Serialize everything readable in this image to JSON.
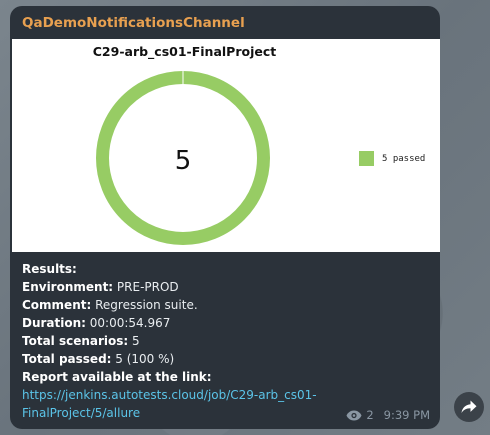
{
  "channel": {
    "name": "QaDemoNotificationsChannel"
  },
  "chart_data": {
    "type": "pie",
    "title": "C29-arb_cs01-FinalProject",
    "center_label": "5",
    "slices": [
      {
        "name": "5 passed",
        "value": 5,
        "color": "#97cc64"
      }
    ],
    "legend_position": "right"
  },
  "message": {
    "results_label": "Results:",
    "environment_label": "Environment:",
    "environment_value": " PRE-PROD",
    "comment_label": "Comment:",
    "comment_value": " Regression suite.",
    "duration_label": "Duration:",
    "duration_value": " 00:00:54.967",
    "scenarios_label": "Total scenarios:",
    "scenarios_value": " 5",
    "passed_label": "Total passed:",
    "passed_value": " 5 (100 %)",
    "report_label": "Report available at the link:",
    "report_link_line1": "https://jenkins.autotests.cloud/job/C29-arb_cs01-",
    "report_link_line2": "FinalProject/5/allure"
  },
  "meta": {
    "views": "2",
    "time": "9:39 PM"
  },
  "colors": {
    "channel_name": "#e8a050",
    "link": "#5bc4e8",
    "bubble_bg": "#2b323a",
    "passed_green": "#97cc64"
  },
  "icons": {
    "views": "eye-icon",
    "share": "share-arrow-icon"
  }
}
